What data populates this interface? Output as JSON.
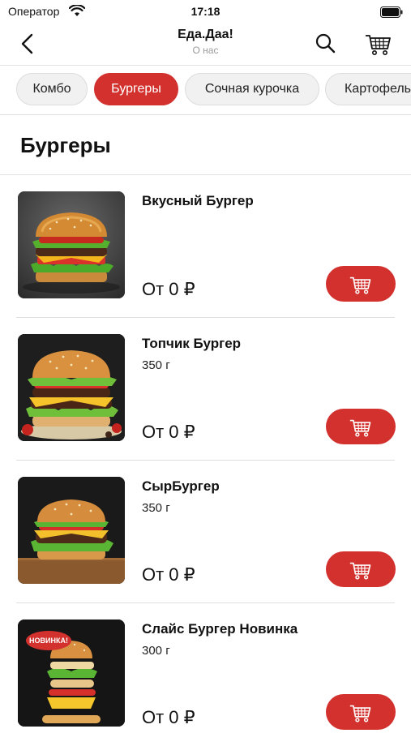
{
  "status_bar": {
    "carrier": "Оператор",
    "time": "17:18"
  },
  "nav": {
    "title": "Еда.Даа!",
    "subtitle": "О нас",
    "icons": [
      "chevron-left-icon",
      "search-icon",
      "cart-icon"
    ]
  },
  "categories": [
    {
      "label": "Комбо",
      "active": false
    },
    {
      "label": "Бургеры",
      "active": true
    },
    {
      "label": "Сочная курочка",
      "active": false
    },
    {
      "label": "Картофель",
      "active": false
    }
  ],
  "section": {
    "title": "Бургеры"
  },
  "products": [
    {
      "name": "Вкусный Бургер",
      "weight": "",
      "price": "От 0 ₽"
    },
    {
      "name": "Топчик Бургер",
      "weight": "350 г",
      "price": "От 0 ₽"
    },
    {
      "name": "СырБургер",
      "weight": "350 г",
      "price": "От 0 ₽"
    },
    {
      "name": "Слайс Бургер Новинка",
      "weight": "300 г",
      "price": "От 0 ₽",
      "badge": "НОВИНКА!"
    }
  ],
  "colors": {
    "accent": "#d2312e",
    "chip_bg": "#f1f1f1",
    "divider": "#e2e2e2"
  }
}
